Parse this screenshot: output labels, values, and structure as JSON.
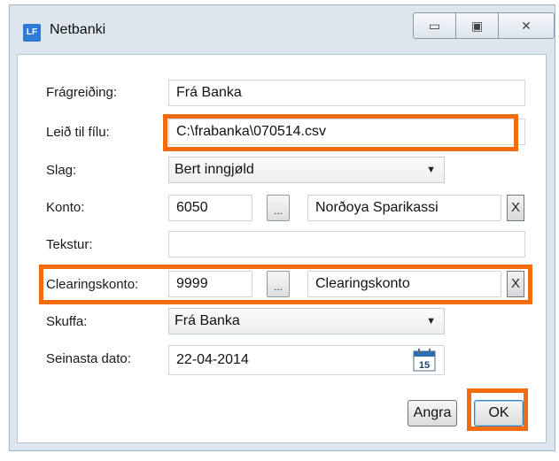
{
  "window": {
    "title": "Netbanki",
    "app_icon_text": "LF",
    "controls": {
      "minimize": "▭",
      "maximize": "▣",
      "close": "✕"
    }
  },
  "form": {
    "fragreiding": {
      "label": "Frágreiðing:",
      "value": "Frá Banka"
    },
    "leid": {
      "label": "Leið til fílu:",
      "value": "C:\\frabanka\\070514.csv"
    },
    "slag": {
      "label": "Slag:",
      "value": "Bert inngjøld"
    },
    "konto": {
      "label": "Konto:",
      "value": "6050",
      "browse": "...",
      "name": "Norðoya Sparikassi",
      "clear": "X"
    },
    "tekstur": {
      "label": "Tekstur:",
      "value": ""
    },
    "clearingskonto": {
      "label": "Clearingskonto:",
      "value": "9999",
      "browse": "...",
      "name": "Clearingskonto",
      "clear": "X"
    },
    "skuffa": {
      "label": "Skuffa:",
      "value": "Frá Banka"
    },
    "seinasta_dato": {
      "label": "Seinasta dato:",
      "value": "22-04-2014",
      "calendar_day": "15"
    }
  },
  "buttons": {
    "cancel": "Angra",
    "ok": "OK"
  },
  "colors": {
    "highlight": "#f26b0f",
    "chrome": "#dde6ef",
    "calendar_accent": "#2d6fb5"
  }
}
